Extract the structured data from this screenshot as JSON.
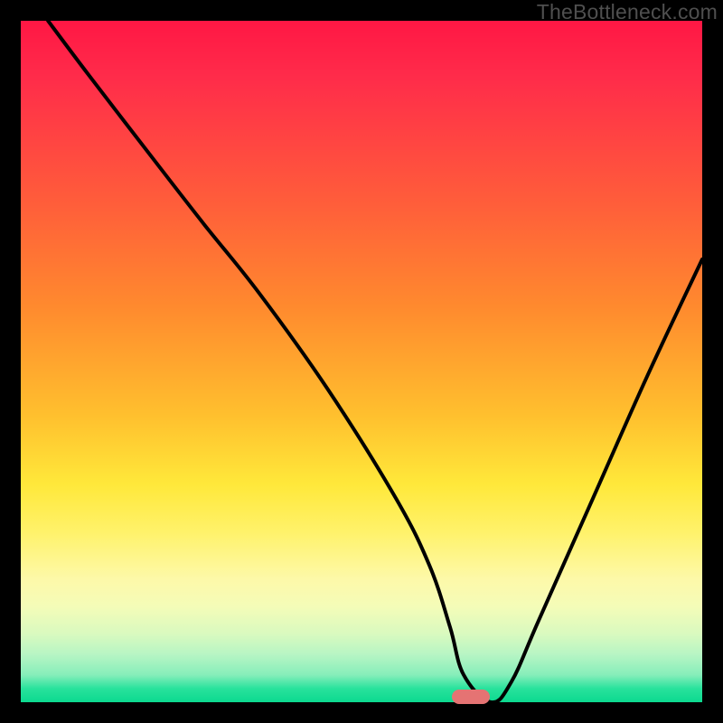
{
  "watermark": "TheBottleneck.com",
  "marker": {
    "x_pct": 66.0,
    "y_pct": 99.2,
    "color": "#e57373"
  },
  "chart_data": {
    "type": "line",
    "title": "",
    "xlabel": "",
    "ylabel": "",
    "xlim": [
      0,
      100
    ],
    "ylim": [
      0,
      100
    ],
    "grid": false,
    "series": [
      {
        "name": "bottleneck-curve",
        "x": [
          4,
          10,
          20,
          27,
          35,
          45,
          55,
          60,
          63,
          65,
          69,
          72,
          76,
          84,
          92,
          100
        ],
        "y": [
          100,
          92,
          79,
          70,
          60,
          46,
          30,
          20,
          11,
          4,
          0,
          3,
          12,
          30,
          48,
          65
        ]
      }
    ],
    "background_gradient": {
      "stops": [
        {
          "pos": 0,
          "color": "#ff1744"
        },
        {
          "pos": 27,
          "color": "#ff5e3a"
        },
        {
          "pos": 58,
          "color": "#ffc02e"
        },
        {
          "pos": 82,
          "color": "#fdf9a9"
        },
        {
          "pos": 96,
          "color": "#86eeba"
        },
        {
          "pos": 100,
          "color": "#0cd98f"
        }
      ]
    }
  }
}
